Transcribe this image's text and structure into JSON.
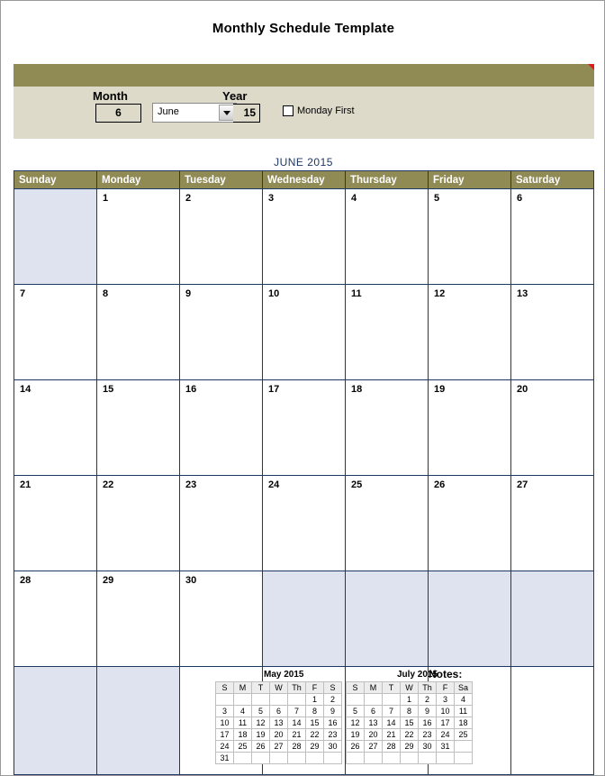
{
  "document": {
    "title": "Monthly Schedule Template"
  },
  "controls": {
    "month_label": "Month",
    "month_value": "6",
    "month_name": "June",
    "year_label": "Year",
    "year_value": "15",
    "monday_first_label": "Monday First",
    "monday_first_checked": false,
    "dropdown_icon": "chevron-down-icon",
    "comment_marker_color": "#E01B1B"
  },
  "calendar": {
    "caption": "JUNE  2015",
    "header_bg": "#908A55",
    "header_fg": "#FFFFFF",
    "grid_line_color": "#1F3864",
    "shaded_cell_color": "#DFE3EF",
    "day_names": [
      "Sunday",
      "Monday",
      "Tuesday",
      "Wednesday",
      "Thursday",
      "Friday",
      "Saturday"
    ],
    "weeks": [
      [
        {
          "day": "",
          "shaded": true
        },
        {
          "day": "1",
          "shaded": false
        },
        {
          "day": "2",
          "shaded": false
        },
        {
          "day": "3",
          "shaded": false
        },
        {
          "day": "4",
          "shaded": false
        },
        {
          "day": "5",
          "shaded": false
        },
        {
          "day": "6",
          "shaded": false
        }
      ],
      [
        {
          "day": "7",
          "shaded": false
        },
        {
          "day": "8",
          "shaded": false
        },
        {
          "day": "9",
          "shaded": false
        },
        {
          "day": "10",
          "shaded": false
        },
        {
          "day": "11",
          "shaded": false
        },
        {
          "day": "12",
          "shaded": false
        },
        {
          "day": "13",
          "shaded": false
        }
      ],
      [
        {
          "day": "14",
          "shaded": false
        },
        {
          "day": "15",
          "shaded": false
        },
        {
          "day": "16",
          "shaded": false
        },
        {
          "day": "17",
          "shaded": false
        },
        {
          "day": "18",
          "shaded": false
        },
        {
          "day": "19",
          "shaded": false
        },
        {
          "day": "20",
          "shaded": false
        }
      ],
      [
        {
          "day": "21",
          "shaded": false
        },
        {
          "day": "22",
          "shaded": false
        },
        {
          "day": "23",
          "shaded": false
        },
        {
          "day": "24",
          "shaded": false
        },
        {
          "day": "25",
          "shaded": false
        },
        {
          "day": "26",
          "shaded": false
        },
        {
          "day": "27",
          "shaded": false
        }
      ],
      [
        {
          "day": "28",
          "shaded": false
        },
        {
          "day": "29",
          "shaded": false
        },
        {
          "day": "30",
          "shaded": false
        },
        {
          "day": "",
          "shaded": true
        },
        {
          "day": "",
          "shaded": true
        },
        {
          "day": "",
          "shaded": true
        },
        {
          "day": "",
          "shaded": true
        }
      ],
      [
        {
          "day": "",
          "shaded": true
        },
        {
          "day": "",
          "shaded": true
        },
        {
          "day": "",
          "shaded": false
        },
        {
          "day": "",
          "shaded": false
        },
        {
          "day": "",
          "shaded": false
        },
        {
          "day": "",
          "shaded": false
        },
        {
          "day": "",
          "shaded": false
        }
      ]
    ]
  },
  "mini_calendars": [
    {
      "title": "May 2015",
      "day_names": [
        "S",
        "M",
        "T",
        "W",
        "Th",
        "F",
        "S"
      ],
      "weeks": [
        [
          "",
          "",
          "",
          "",
          "",
          "1",
          "2"
        ],
        [
          "3",
          "4",
          "5",
          "6",
          "7",
          "8",
          "9"
        ],
        [
          "10",
          "11",
          "12",
          "13",
          "14",
          "15",
          "16"
        ],
        [
          "17",
          "18",
          "19",
          "20",
          "21",
          "22",
          "23"
        ],
        [
          "24",
          "25",
          "26",
          "27",
          "28",
          "29",
          "30"
        ],
        [
          "31",
          "",
          "",
          "",
          "",
          "",
          ""
        ]
      ]
    },
    {
      "title": "July 2015",
      "day_names": [
        "S",
        "M",
        "T",
        "W",
        "Th",
        "F",
        "Sa"
      ],
      "weeks": [
        [
          "",
          "",
          "",
          "1",
          "2",
          "3",
          "4"
        ],
        [
          "5",
          "6",
          "7",
          "8",
          "9",
          "10",
          "11"
        ],
        [
          "12",
          "13",
          "14",
          "15",
          "16",
          "17",
          "18"
        ],
        [
          "19",
          "20",
          "21",
          "22",
          "23",
          "24",
          "25"
        ],
        [
          "26",
          "27",
          "28",
          "29",
          "30",
          "31",
          ""
        ],
        [
          "",
          "",
          "",
          "",
          "",
          "",
          ""
        ]
      ]
    }
  ],
  "notes": {
    "label": "Notes:"
  }
}
